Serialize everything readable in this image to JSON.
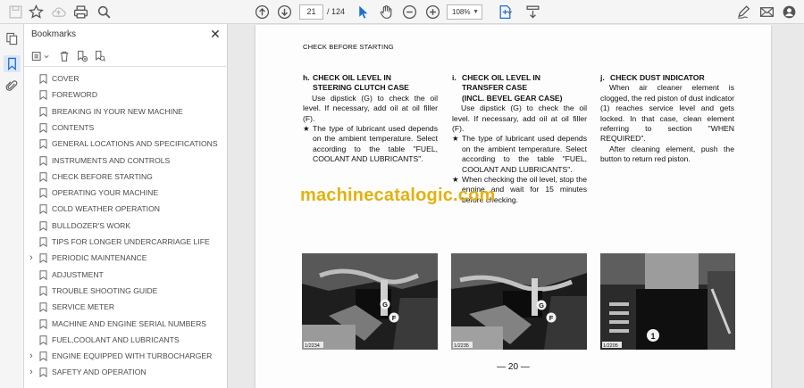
{
  "toolbar": {
    "page_current": "21",
    "page_total": "/ 124",
    "zoom": "108%"
  },
  "bookmarks": {
    "title": "Bookmarks",
    "items": [
      {
        "label": "COVER",
        "expandable": false
      },
      {
        "label": "FOREWORD",
        "expandable": false
      },
      {
        "label": "BREAKING IN YOUR NEW MACHINE",
        "expandable": false
      },
      {
        "label": "CONTENTS",
        "expandable": false
      },
      {
        "label": "GENERAL LOCATIONS AND SPECIFICATIONS",
        "expandable": false
      },
      {
        "label": "INSTRUMENTS AND CONTROLS",
        "expandable": false
      },
      {
        "label": "CHECK BEFORE STARTING",
        "expandable": false
      },
      {
        "label": "OPERATING YOUR MACHINE",
        "expandable": false
      },
      {
        "label": "COLD WEATHER OPERATION",
        "expandable": false
      },
      {
        "label": "BULLDOZER'S WORK",
        "expandable": false
      },
      {
        "label": "TIPS FOR LONGER UNDERCARRIAGE LIFE",
        "expandable": false
      },
      {
        "label": "PERIODIC MAINTENANCE",
        "expandable": true
      },
      {
        "label": "ADJUSTMENT",
        "expandable": false
      },
      {
        "label": "TROUBLE SHOOTING GUIDE",
        "expandable": false
      },
      {
        "label": "SERVICE METER",
        "expandable": false
      },
      {
        "label": "MACHINE AND ENGINE SERIAL NUMBERS",
        "expandable": false
      },
      {
        "label": "FUEL,COOLANT AND LUBRICANTS",
        "expandable": false
      },
      {
        "label": "ENGINE EQUIPPED WITH TURBOCHARGER",
        "expandable": true
      },
      {
        "label": "SAFETY AND OPERATION",
        "expandable": true
      }
    ]
  },
  "document": {
    "header": "CHECK BEFORE STARTING",
    "col_h": {
      "letter": "h.",
      "title1": "CHECK OIL LEVEL IN",
      "title2": "STEERING CLUTCH CASE",
      "para": "Use dipstick (G) to check the oil level. If necessary, add oil at oil filler (F).",
      "star": "The type of lubricant used depends on the ambient temperature. Select according to the table \"FUEL, COOLANT AND LUBRICANTS\"."
    },
    "col_i": {
      "letter": "i.",
      "title1": "CHECK OIL LEVEL IN",
      "title2": "TRANSFER CASE",
      "title3": "(INCL. BEVEL GEAR CASE)",
      "para": "Use dipstick (G) to check the oil level. If necessary, add oil at oil filler (F).",
      "star1": "The type of lubricant used depends on the ambient temperature. Select according to the table \"FUEL, COOLANT AND LUBRICANTS\".",
      "star2": "When checking the oil level, stop the engine and wait for 15 minutes before checking."
    },
    "col_j": {
      "letter": "j.",
      "title1": "CHECK DUST INDICATOR",
      "para1": "When air cleaner element is clogged, the red piston of dust indicator (1) reaches service level and gets locked. In that case, clean element referring to section \"WHEN REQUIRED\".",
      "para2": "After cleaning element, push the button to return red piston."
    },
    "photos": [
      {
        "code": "1/2234",
        "labels": [
          "G",
          "F"
        ]
      },
      {
        "code": "1/2235",
        "labels": [
          "G",
          "F"
        ]
      },
      {
        "code": "1/2205",
        "labels": [
          "1"
        ]
      }
    ],
    "page_number": "— 20 —",
    "watermark": "machinecatalogic.com"
  }
}
